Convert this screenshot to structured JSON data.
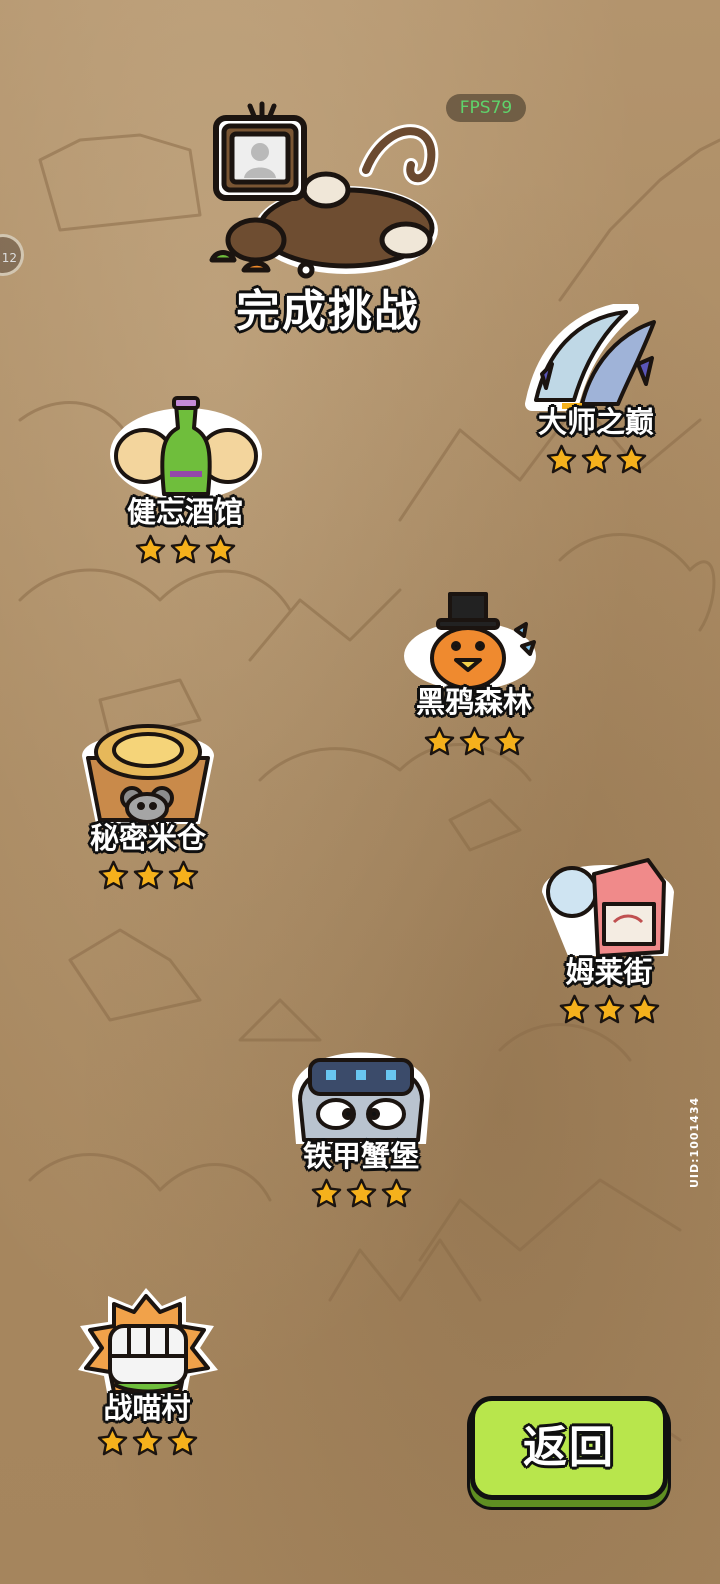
{
  "hud": {
    "fps": "FPS79",
    "side_badge": "12",
    "uid": "UID:1001434"
  },
  "header": {
    "title": "完成挑战"
  },
  "stages": [
    {
      "id": "master-peak",
      "name": "大师之巅",
      "stars": 3
    },
    {
      "id": "forgetful-tavern",
      "name": "健忘酒馆",
      "stars": 3
    },
    {
      "id": "black-crow-forest",
      "name": "黑鸦森林",
      "stars": 3
    },
    {
      "id": "secret-granary",
      "name": "秘密米仓",
      "stars": 3
    },
    {
      "id": "mulai-street",
      "name": "姆莱街",
      "stars": 3
    },
    {
      "id": "iron-crab-fortress",
      "name": "铁甲蟹堡",
      "stars": 3
    },
    {
      "id": "war-meow-village",
      "name": "战喵村",
      "stars": 3
    }
  ],
  "actions": {
    "back_label": "返回"
  },
  "colors": {
    "star_fill": "#f5b11c",
    "button_green": "#b8e64c",
    "map_paper": "#a88a64",
    "fps_text": "#5fd26b"
  }
}
